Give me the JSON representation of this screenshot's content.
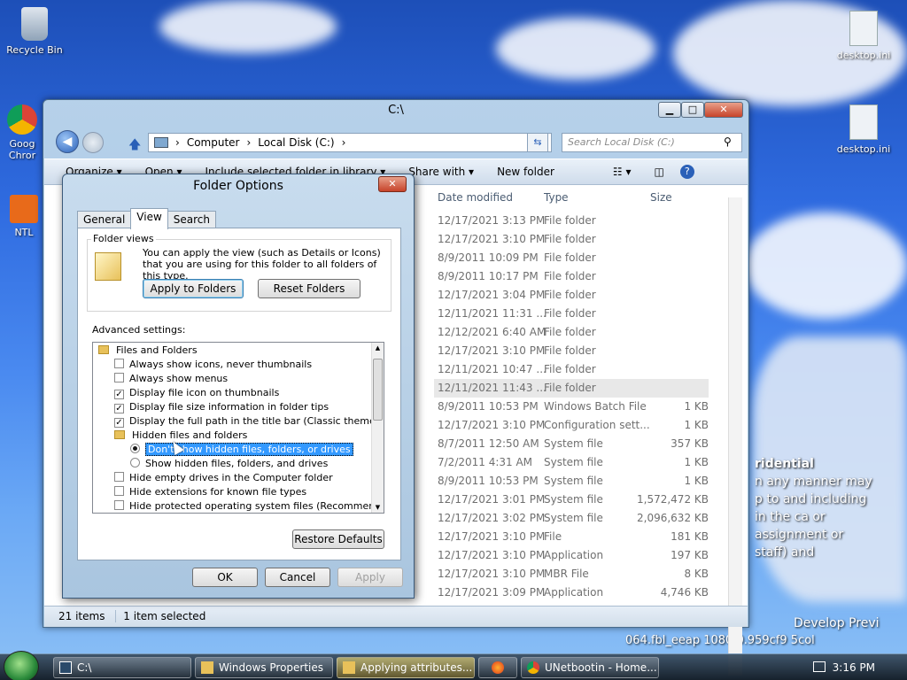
{
  "desktop": {
    "icons": [
      {
        "label": "Recycle Bin"
      },
      {
        "label": "Goog Chror"
      },
      {
        "label": "NTL"
      },
      {
        "label": "desktop.ini"
      },
      {
        "label": "desktop.ini"
      }
    ],
    "wallpaper_text": {
      "heading": "ridential",
      "lines": [
        "n any manner may",
        "p to and including",
        "in the ca or",
        "assignment or",
        "staff) and"
      ],
      "bottom1": "Develop Previ",
      "bottom2": "064.fbl_eeap 1080 0.959cf9 5col"
    }
  },
  "explorer": {
    "title": "C:\\",
    "window_buttons": {
      "minimize": "▁",
      "maximize": "□",
      "close": "✕"
    },
    "breadcrumb": [
      "Computer",
      "Local Disk (C:)"
    ],
    "search_placeholder": "Search Local Disk (C:)",
    "toolbar": [
      "Organize ▾",
      "Open ▾",
      "Include selected folder in library ▾",
      "Share with ▾",
      "New folder"
    ],
    "columns": {
      "date": "Date modified",
      "type": "Type",
      "size": "Size"
    },
    "rows": [
      {
        "date": "12/17/2021 3:13 PM",
        "type": "File folder",
        "size": ""
      },
      {
        "date": "12/17/2021 3:10 PM",
        "type": "File folder",
        "size": ""
      },
      {
        "date": "8/9/2011 10:09 PM",
        "type": "File folder",
        "size": ""
      },
      {
        "date": "8/9/2011 10:17 PM",
        "type": "File folder",
        "size": ""
      },
      {
        "date": "12/17/2021 3:04 PM",
        "type": "File folder",
        "size": ""
      },
      {
        "date": "12/11/2021 11:31 ...",
        "type": "File folder",
        "size": ""
      },
      {
        "date": "12/12/2021 6:40 AM",
        "type": "File folder",
        "size": ""
      },
      {
        "date": "12/17/2021 3:10 PM",
        "type": "File folder",
        "size": ""
      },
      {
        "date": "12/11/2021 10:47 ...",
        "type": "File folder",
        "size": ""
      },
      {
        "date": "12/11/2021 11:43 ...",
        "type": "File folder",
        "size": ""
      },
      {
        "date": "8/9/2011 10:53 PM",
        "type": "Windows Batch File",
        "size": "1 KB"
      },
      {
        "date": "12/17/2021 3:10 PM",
        "type": "Configuration sett...",
        "size": "1 KB"
      },
      {
        "date": "8/7/2011 12:50 AM",
        "type": "System file",
        "size": "357 KB"
      },
      {
        "date": "7/2/2011 4:31 AM",
        "type": "System file",
        "size": "1 KB"
      },
      {
        "date": "8/9/2011 10:53 PM",
        "type": "System file",
        "size": "1 KB"
      },
      {
        "date": "12/17/2021 3:01 PM",
        "type": "System file",
        "size": "1,572,472 KB"
      },
      {
        "date": "12/17/2021 3:02 PM",
        "type": "System file",
        "size": "2,096,632 KB"
      },
      {
        "date": "12/17/2021 3:10 PM",
        "type": "File",
        "size": "181 KB"
      },
      {
        "date": "12/17/2021 3:10 PM",
        "type": "Application",
        "size": "197 KB"
      },
      {
        "date": "12/17/2021 3:10 PM",
        "type": "MBR File",
        "size": "8 KB"
      },
      {
        "date": "12/17/2021 3:09 PM",
        "type": "Application",
        "size": "4,746 KB"
      }
    ],
    "status": {
      "items": "21 items",
      "selected": "1 item selected"
    }
  },
  "dialog": {
    "title": "Folder Options",
    "close": "✕",
    "tabs": [
      "General",
      "View",
      "Search"
    ],
    "folder_views": {
      "label": "Folder views",
      "description": "You can apply the view (such as Details or Icons) that you are using for this folder to all folders of this type.",
      "apply_button": "Apply to Folders",
      "reset_button": "Reset Folders"
    },
    "advanced_label": "Advanced settings:",
    "tree": [
      {
        "kind": "folder",
        "label": "Files and Folders"
      },
      {
        "kind": "check",
        "checked": false,
        "label": "Always show icons, never thumbnails"
      },
      {
        "kind": "check",
        "checked": false,
        "label": "Always show menus"
      },
      {
        "kind": "check",
        "checked": true,
        "label": "Display file icon on thumbnails"
      },
      {
        "kind": "check",
        "checked": true,
        "label": "Display file size information in folder tips"
      },
      {
        "kind": "check",
        "checked": true,
        "label": "Display the full path in the title bar (Classic theme only)"
      },
      {
        "kind": "folder",
        "label": "Hidden files and folders"
      },
      {
        "kind": "radio",
        "checked": true,
        "label": "Don't show hidden files, folders, or drives"
      },
      {
        "kind": "radio",
        "checked": false,
        "label": "Show hidden files, folders, and drives"
      },
      {
        "kind": "check",
        "checked": false,
        "label": "Hide empty drives in the Computer folder"
      },
      {
        "kind": "check",
        "checked": false,
        "label": "Hide extensions for known file types"
      },
      {
        "kind": "check",
        "checked": false,
        "label": "Hide protected operating system files (Recommended)"
      }
    ],
    "restore_button": "Restore Defaults",
    "ok": "OK",
    "cancel": "Cancel",
    "apply": "Apply"
  },
  "taskbar": {
    "tasks": [
      {
        "label": "C:\\"
      },
      {
        "label": "Windows Properties"
      },
      {
        "label": "Applying attributes..."
      },
      {
        "label": ""
      },
      {
        "label": "UNetbootin - Home..."
      }
    ],
    "clock": "3:16 PM"
  }
}
